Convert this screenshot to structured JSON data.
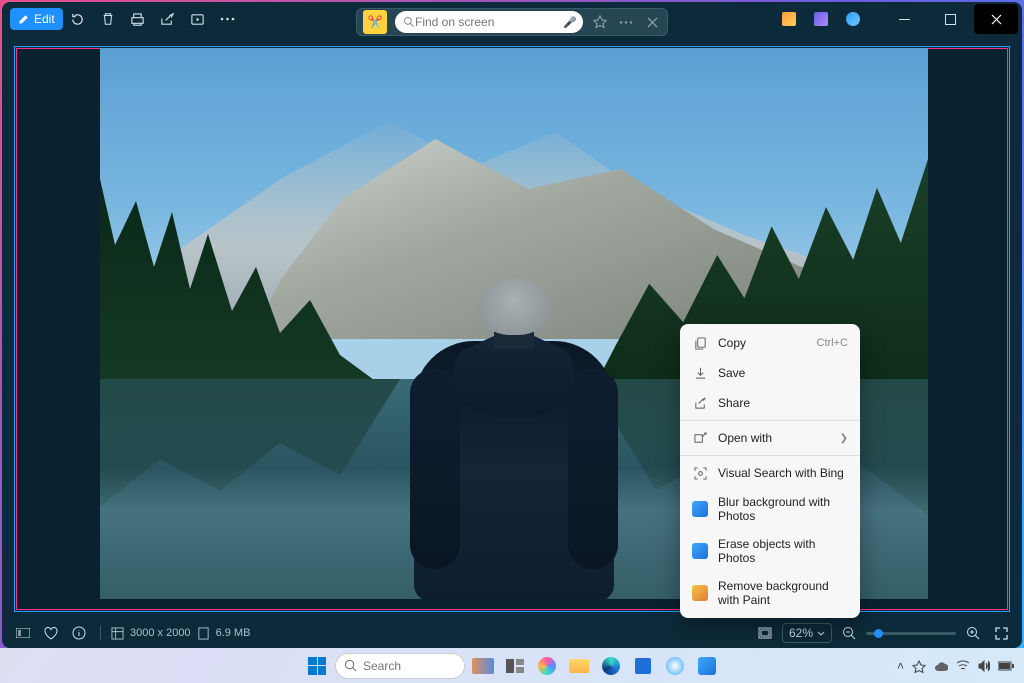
{
  "topbar": {
    "edit_label": "Edit",
    "search_placeholder": "Find on screen"
  },
  "context_menu": {
    "copy": "Copy",
    "copy_kb": "Ctrl+C",
    "save": "Save",
    "share": "Share",
    "open_with": "Open with",
    "visual_search": "Visual Search with Bing",
    "blur_bg": "Blur background with Photos",
    "erase_obj": "Erase objects with Photos",
    "remove_bg": "Remove background with Paint"
  },
  "bottombar": {
    "dimensions": "3000 x 2000",
    "filesize": "6.9 MB",
    "zoom": "62%"
  },
  "taskbar": {
    "search_placeholder": "Search"
  }
}
